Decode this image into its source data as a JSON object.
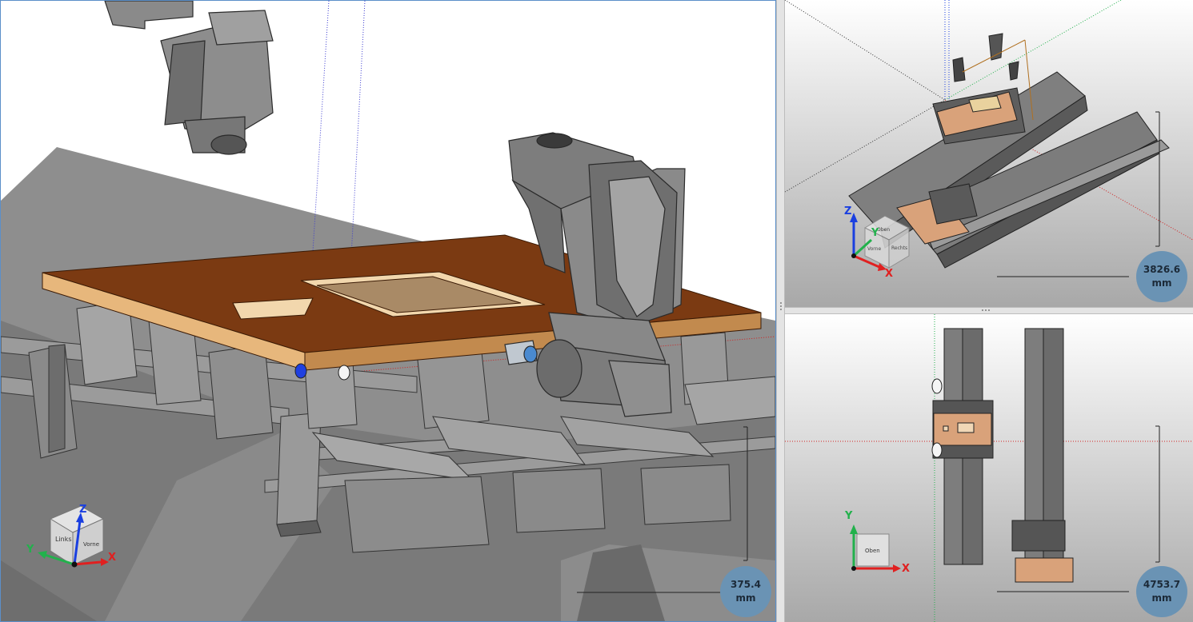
{
  "main_view": {
    "scale_value": "375.4",
    "scale_unit": "mm",
    "viewcube": {
      "face_left": "Links",
      "face_front": "Vorne"
    },
    "axes": {
      "x": "X",
      "y": "Y",
      "z": "Z"
    }
  },
  "top_right_view": {
    "scale_value": "3826.6",
    "scale_unit": "mm",
    "viewcube": {
      "face_top": "Oben",
      "face_front": "Vorne",
      "face_right": "Rechts"
    },
    "axes": {
      "x": "X",
      "y": "Y",
      "z": "Z"
    }
  },
  "bottom_right_view": {
    "scale_value": "4753.7",
    "scale_unit": "mm",
    "viewcube": {
      "face_top": "Oben"
    },
    "axes": {
      "x": "X",
      "y": "Y"
    }
  },
  "colors": {
    "viewport_border": "#5b8fc9",
    "badge": "#6a93b4",
    "axis_x": "#e02020",
    "axis_y": "#22b14c",
    "axis_z": "#1a3fe0",
    "workpiece": "#7b3a12",
    "workpiece_edge": "#e7b77c",
    "machine_gray": "#808080"
  }
}
